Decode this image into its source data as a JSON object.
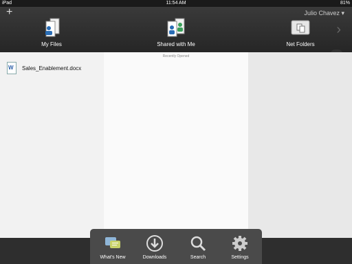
{
  "status_bar": {
    "device": "iPad",
    "time": "11:54 AM",
    "battery": "81%"
  },
  "header": {
    "add_label": "+",
    "user_name": "Julio Chavez",
    "nav": [
      {
        "label": "My Files",
        "icon": "my-files-icon"
      },
      {
        "label": "Shared with Me",
        "icon": "shared-with-me-icon"
      },
      {
        "label": "Net Folders",
        "icon": "net-folders-icon"
      }
    ],
    "next_arrow": "›"
  },
  "center": {
    "recent_label": "Recently Opened"
  },
  "files": [
    {
      "name": "Sales_Enablement.docx",
      "icon": "word-doc-icon"
    }
  ],
  "dock": [
    {
      "label": "What's New",
      "icon": "whats-new-icon"
    },
    {
      "label": "Downloads",
      "icon": "download-icon"
    },
    {
      "label": "Search",
      "icon": "search-icon"
    },
    {
      "label": "Settings",
      "icon": "gear-icon"
    }
  ]
}
